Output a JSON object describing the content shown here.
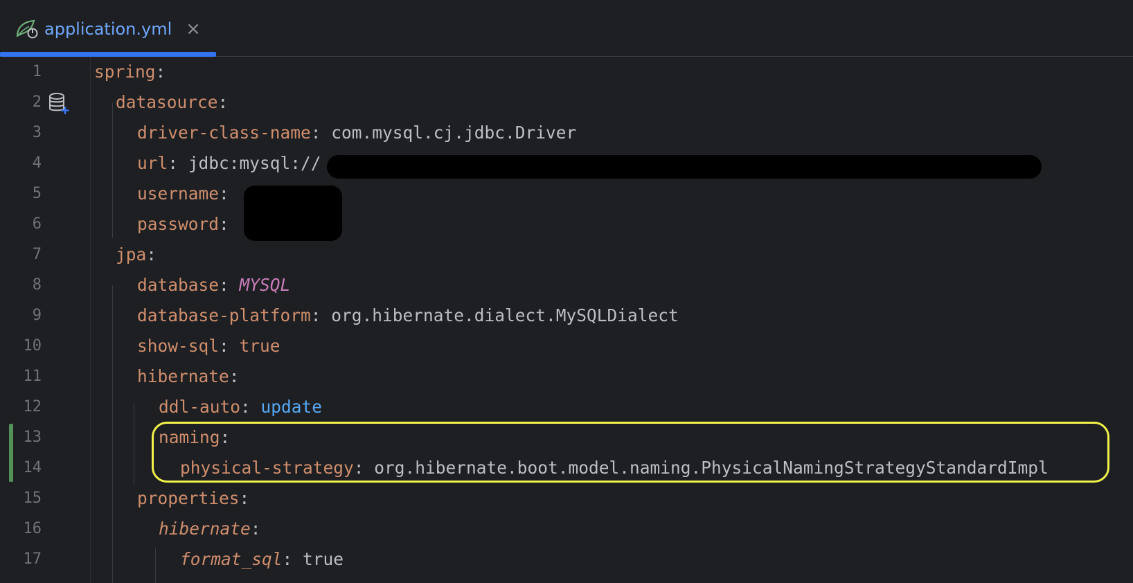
{
  "tab": {
    "label": "application.yml",
    "close_glyph": "×",
    "icon": "spring-boot-icon"
  },
  "gutter_icon": "database-add-icon",
  "highlight_color": "#f2f24a",
  "change_marker_color": "#549159",
  "lines": [
    {
      "num": "1",
      "key": "spring",
      "colon": ":",
      "value": ""
    },
    {
      "num": "2",
      "key": "datasource",
      "colon": ":",
      "value": ""
    },
    {
      "num": "3",
      "key": "driver-class-name",
      "colon": ":",
      "value": " com.mysql.cj.jdbc.Driver"
    },
    {
      "num": "4",
      "key": "url",
      "colon": ":",
      "value": " jdbc:mysql://"
    },
    {
      "num": "5",
      "key": "username",
      "colon": ":",
      "value": ""
    },
    {
      "num": "6",
      "key": "password",
      "colon": ":",
      "value": ""
    },
    {
      "num": "7",
      "key": "jpa",
      "colon": ":",
      "value": ""
    },
    {
      "num": "8",
      "key": "database",
      "colon": ": ",
      "value": "MYSQL"
    },
    {
      "num": "9",
      "key": "database-platform",
      "colon": ":",
      "value": " org.hibernate.dialect.MySQLDialect"
    },
    {
      "num": "10",
      "key": "show-sql",
      "colon": ": ",
      "value": "true"
    },
    {
      "num": "11",
      "key": "hibernate",
      "colon": ":",
      "value": ""
    },
    {
      "num": "12",
      "key": "ddl-auto",
      "colon": ": ",
      "value": "update"
    },
    {
      "num": "13",
      "key": "naming",
      "colon": ":",
      "value": ""
    },
    {
      "num": "14",
      "key": "physical-strategy",
      "colon": ":",
      "value": " org.hibernate.boot.model.naming.PhysicalNamingStrategyStandardImpl"
    },
    {
      "num": "15",
      "key": "properties",
      "colon": ":",
      "value": ""
    },
    {
      "num": "16",
      "key": "hibernate",
      "colon": ":",
      "value": ""
    },
    {
      "num": "17",
      "key": "format_sql",
      "colon": ":",
      "value": " true"
    }
  ]
}
